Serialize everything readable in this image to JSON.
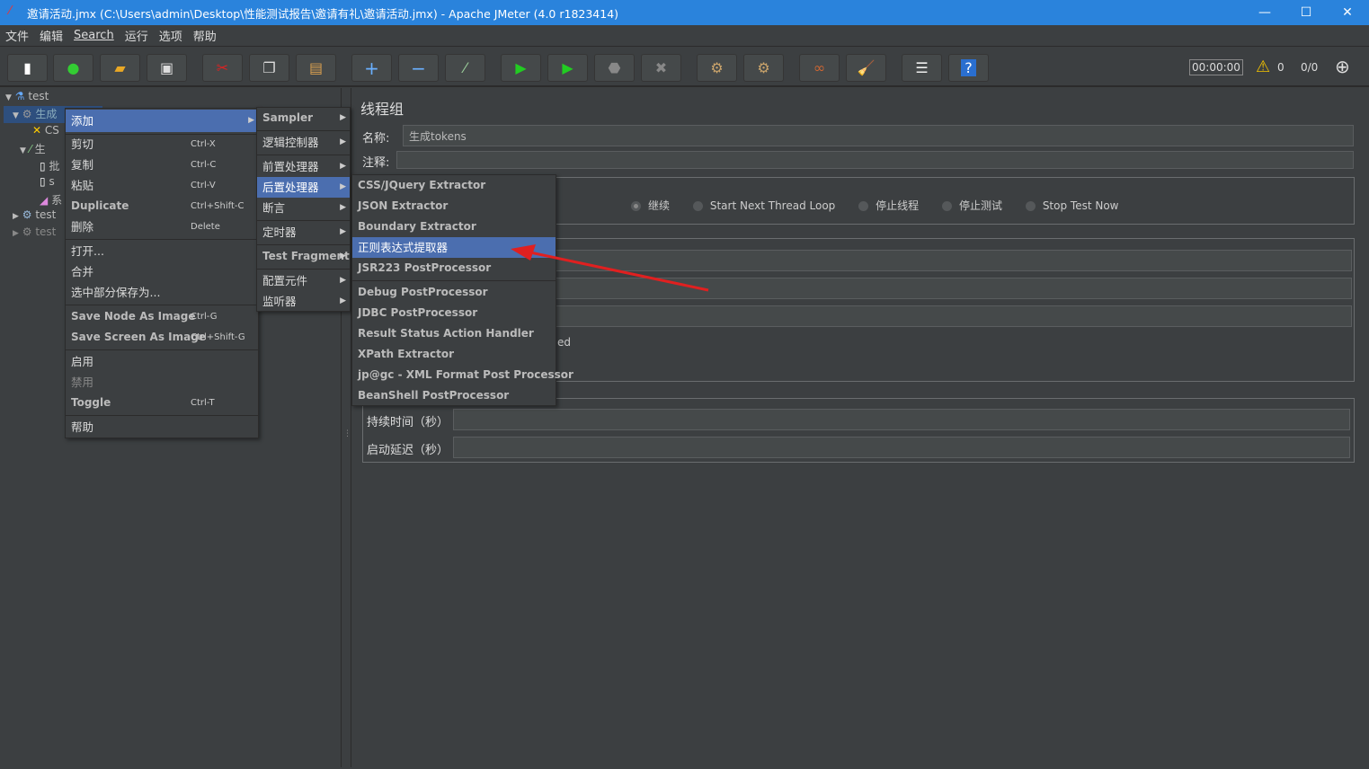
{
  "window": {
    "title": "邀请活动.jmx (C:\\Users\\admin\\Desktop\\性能测试报告\\邀请有礼\\邀请活动.jmx) - Apache JMeter (4.0 r1823414)",
    "minimize": "—",
    "maximize": "☐",
    "close": "✕"
  },
  "menubar": [
    "文件",
    "编辑",
    "Search",
    "运行",
    "选项",
    "帮助"
  ],
  "toolbar": {
    "icons": [
      "new-icon",
      "templates-icon",
      "open-icon",
      "save-icon",
      "cut-icon",
      "copy-icon",
      "paste-icon",
      "expand-icon",
      "collapse-icon",
      "toggle-icon",
      "start-icon",
      "start-no-pause-icon",
      "stop-icon",
      "shutdown-icon",
      "clear-icon",
      "clear-all-icon",
      "search-icon",
      "reset-search-icon",
      "function-helper-icon",
      "help-icon"
    ],
    "timer": "00:00:00",
    "warnings": "0",
    "threads": "0/0"
  },
  "tree": {
    "items": [
      "test",
      "生成",
      "CS",
      "生",
      "批",
      "s",
      "系",
      "test",
      "test"
    ]
  },
  "context_menu": {
    "items": [
      {
        "label": "添加",
        "shortcut": ""
      },
      {
        "label": "剪切",
        "shortcut": "Ctrl-X"
      },
      {
        "label": "复制",
        "shortcut": "Ctrl-C"
      },
      {
        "label": "粘贴",
        "shortcut": "Ctrl-V"
      },
      {
        "label": "Duplicate",
        "shortcut": "Ctrl+Shift-C"
      },
      {
        "label": "删除",
        "shortcut": "Delete"
      },
      {
        "label": "打开...",
        "shortcut": ""
      },
      {
        "label": "合并",
        "shortcut": ""
      },
      {
        "label": "选中部分保存为...",
        "shortcut": ""
      },
      {
        "label": "Save Node As Image",
        "shortcut": "Ctrl-G"
      },
      {
        "label": "Save Screen As Image",
        "shortcut": "Ctrl+Shift-G"
      },
      {
        "label": "启用",
        "shortcut": ""
      },
      {
        "label": "禁用",
        "shortcut": ""
      },
      {
        "label": "Toggle",
        "shortcut": "Ctrl-T"
      },
      {
        "label": "帮助",
        "shortcut": ""
      }
    ]
  },
  "add_submenu": {
    "items": [
      "Sampler",
      "逻辑控制器",
      "前置处理器",
      "后置处理器",
      "断言",
      "定时器",
      "Test Fragment",
      "配置元件",
      "监听器"
    ]
  },
  "post_submenu": {
    "items": [
      "CSS/JQuery Extractor",
      "JSON Extractor",
      "Boundary Extractor",
      "正则表达式提取器",
      "JSR223 PostProcessor",
      "Debug PostProcessor",
      "JDBC PostProcessor",
      "Result Status Action Handler",
      "XPath Extractor",
      "jp@gc - XML Format Post Processor",
      "BeanShell PostProcessor"
    ]
  },
  "main": {
    "title": "线程组",
    "name_label": "名称:",
    "name_value": "生成tokens",
    "comment_label": "注释:",
    "radios": [
      "继续",
      "Start Next Thread Loop",
      "停止线程",
      "停止测试",
      "Stop Test Now"
    ],
    "partial_text": "ed",
    "duration_label": "持续时间（秒）",
    "delay_label": "启动延迟（秒）"
  },
  "colors": {
    "titlebar": "#2a83dc",
    "selection": "#4b6eaf",
    "arrow": "#e02020"
  }
}
